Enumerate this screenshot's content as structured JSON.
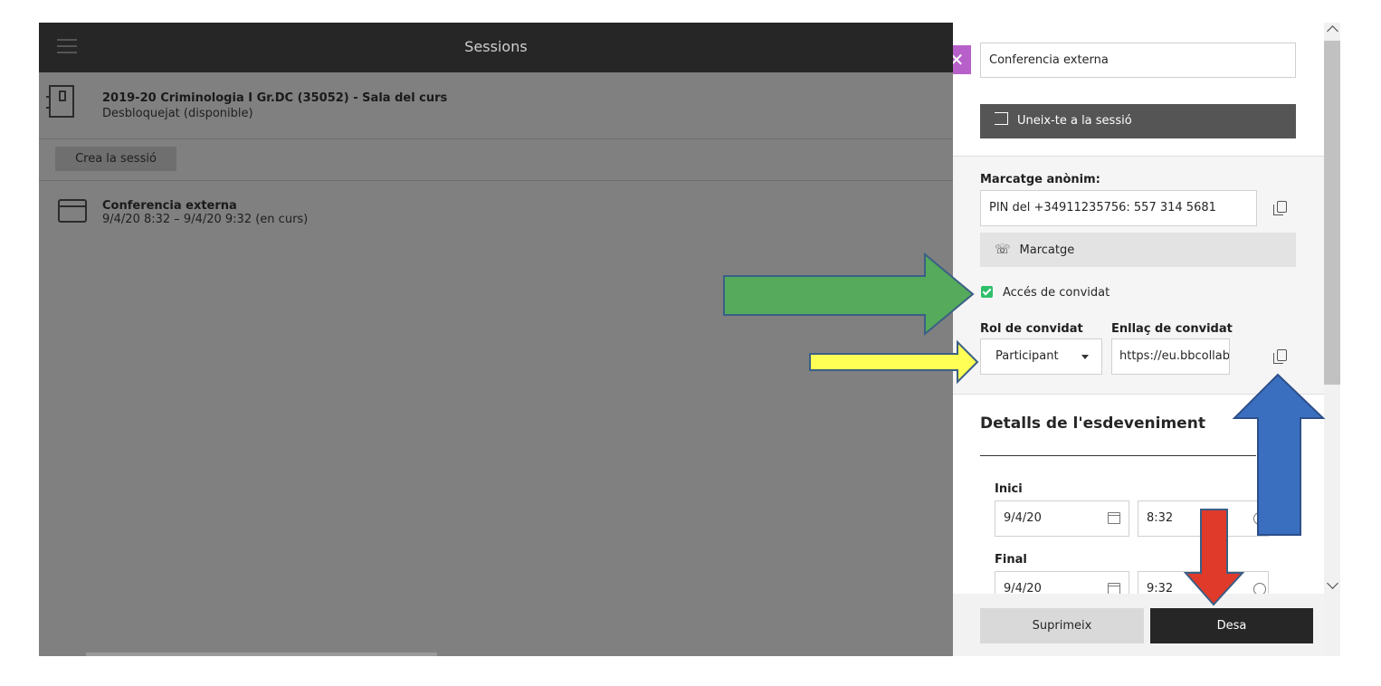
{
  "topbar": {
    "title": "Sessions"
  },
  "course": {
    "title": "2019-20 Criminologia I Gr.DC (35052) - Sala del curs",
    "status": "Desbloquejat (disponible)"
  },
  "create_session_label": "Crea la sessió",
  "sessions": [
    {
      "title": "Conferencia externa",
      "time": "9/4/20 8:32 – 9/4/20 9:32 (en curs)"
    }
  ],
  "panel": {
    "session_name": "Conferencia externa",
    "join_label": "Uneix-te a la sessió",
    "anon_dial_label": "Marcatge anònim:",
    "pin_value": "PIN del +34911235756: 557 314 5681",
    "dial_label": "Marcatge",
    "guest_access_label": "Accés de convidat",
    "guest_access_checked": true,
    "guest_role_label": "Rol de convidat",
    "guest_link_label": "Enllaç de convidat",
    "guest_role_value": "Participant",
    "guest_link_value": "https://eu.bbcollab.com",
    "event_details_title": "Detalls de l'esdeveniment",
    "start_label": "Inici",
    "start_date": "9/4/20",
    "start_time": "8:32",
    "end_label": "Final",
    "end_date": "9/4/20",
    "end_time": "9:32",
    "delete_label": "Suprimeix",
    "save_label": "Desa"
  },
  "icons": {
    "menu": "hamburger-icon",
    "close": "close-icon",
    "join": "enter-icon",
    "copy": "copy-icon",
    "phone": "phone-icon",
    "calendar": "calendar-icon",
    "clock": "clock-icon",
    "room": "room-door-icon"
  },
  "colors": {
    "accent_close": "#b760c9",
    "checkbox": "#2fbf6b",
    "arrow_green": "#55aa5b",
    "arrow_yellow": "#ffff55",
    "arrow_blue": "#3a6fc0",
    "arrow_red": "#e03a2a"
  }
}
